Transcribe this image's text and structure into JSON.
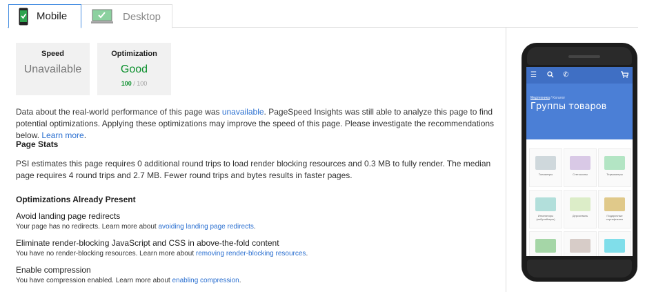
{
  "tabs": [
    {
      "label": "Mobile",
      "active": true
    },
    {
      "label": "Desktop",
      "active": false
    }
  ],
  "cards": {
    "speed": {
      "title": "Speed",
      "value": "Unavailable"
    },
    "optimization": {
      "title": "Optimization",
      "value": "Good",
      "score": "100",
      "score_total": " / 100"
    }
  },
  "intro": {
    "t1": "Data about the real-world performance of this page was ",
    "link1": "unavailable",
    "t2": ". PageSpeed Insights was still able to analyze this page to find potential optimizations. Applying these optimizations may improve the speed of this page. Please investigate the recommendations below. ",
    "link2": "Learn more",
    "t3": "."
  },
  "page_stats": {
    "heading": "Page Stats",
    "text": "PSI estimates this page requires 0 additional round trips to load render blocking resources and 0.3 MB to fully render. The median page requires 4 round trips and 2.7 MB. Fewer round trips and bytes results in faster pages."
  },
  "optimizations": {
    "heading": "Optimizations Already Present",
    "rules": [
      {
        "title": "Avoid landing page redirects",
        "desc": "Your page has no redirects. Learn more about ",
        "link": "avoiding landing page redirects",
        "end": "."
      },
      {
        "title": "Eliminate render-blocking JavaScript and CSS in above-the-fold content",
        "desc": "You have no render-blocking resources. Learn more about ",
        "link": "removing render-blocking resources",
        "end": "."
      },
      {
        "title": "Enable compression",
        "desc": "You have compression enabled. Learn more about ",
        "link": "enabling compression",
        "end": "."
      }
    ]
  },
  "phone_preview": {
    "breadcrumb_home": "Медтехника",
    "breadcrumb_sep": " / Каталог",
    "title": "Группы товаров",
    "nav_icons": [
      "menu-icon",
      "search-icon",
      "phone-icon",
      "cart-icon"
    ],
    "categories": [
      {
        "label": "Тонометры",
        "color": "#cfd8dc"
      },
      {
        "label": "Cтетоскопы",
        "color": "#d9c9e6"
      },
      {
        "label": "Термометры",
        "color": "#b3e5c4"
      },
      {
        "label": "Ингаляторы (небулайзеры)",
        "color": "#b2dfdb"
      },
      {
        "label": "Дерсонваль",
        "color": "#dcedc8"
      },
      {
        "label": "Подарочные сертификаты",
        "color": "#e0c98a"
      },
      {
        "label": "",
        "color": "#a5d6a7"
      },
      {
        "label": "",
        "color": "#d7ccc8"
      },
      {
        "label": "",
        "color": "#80deea"
      }
    ]
  },
  "colors": {
    "accent": "#4a90e2",
    "good": "#0a8f2c",
    "link": "#2a6fd0",
    "phone_header": "#4b7fd6"
  }
}
